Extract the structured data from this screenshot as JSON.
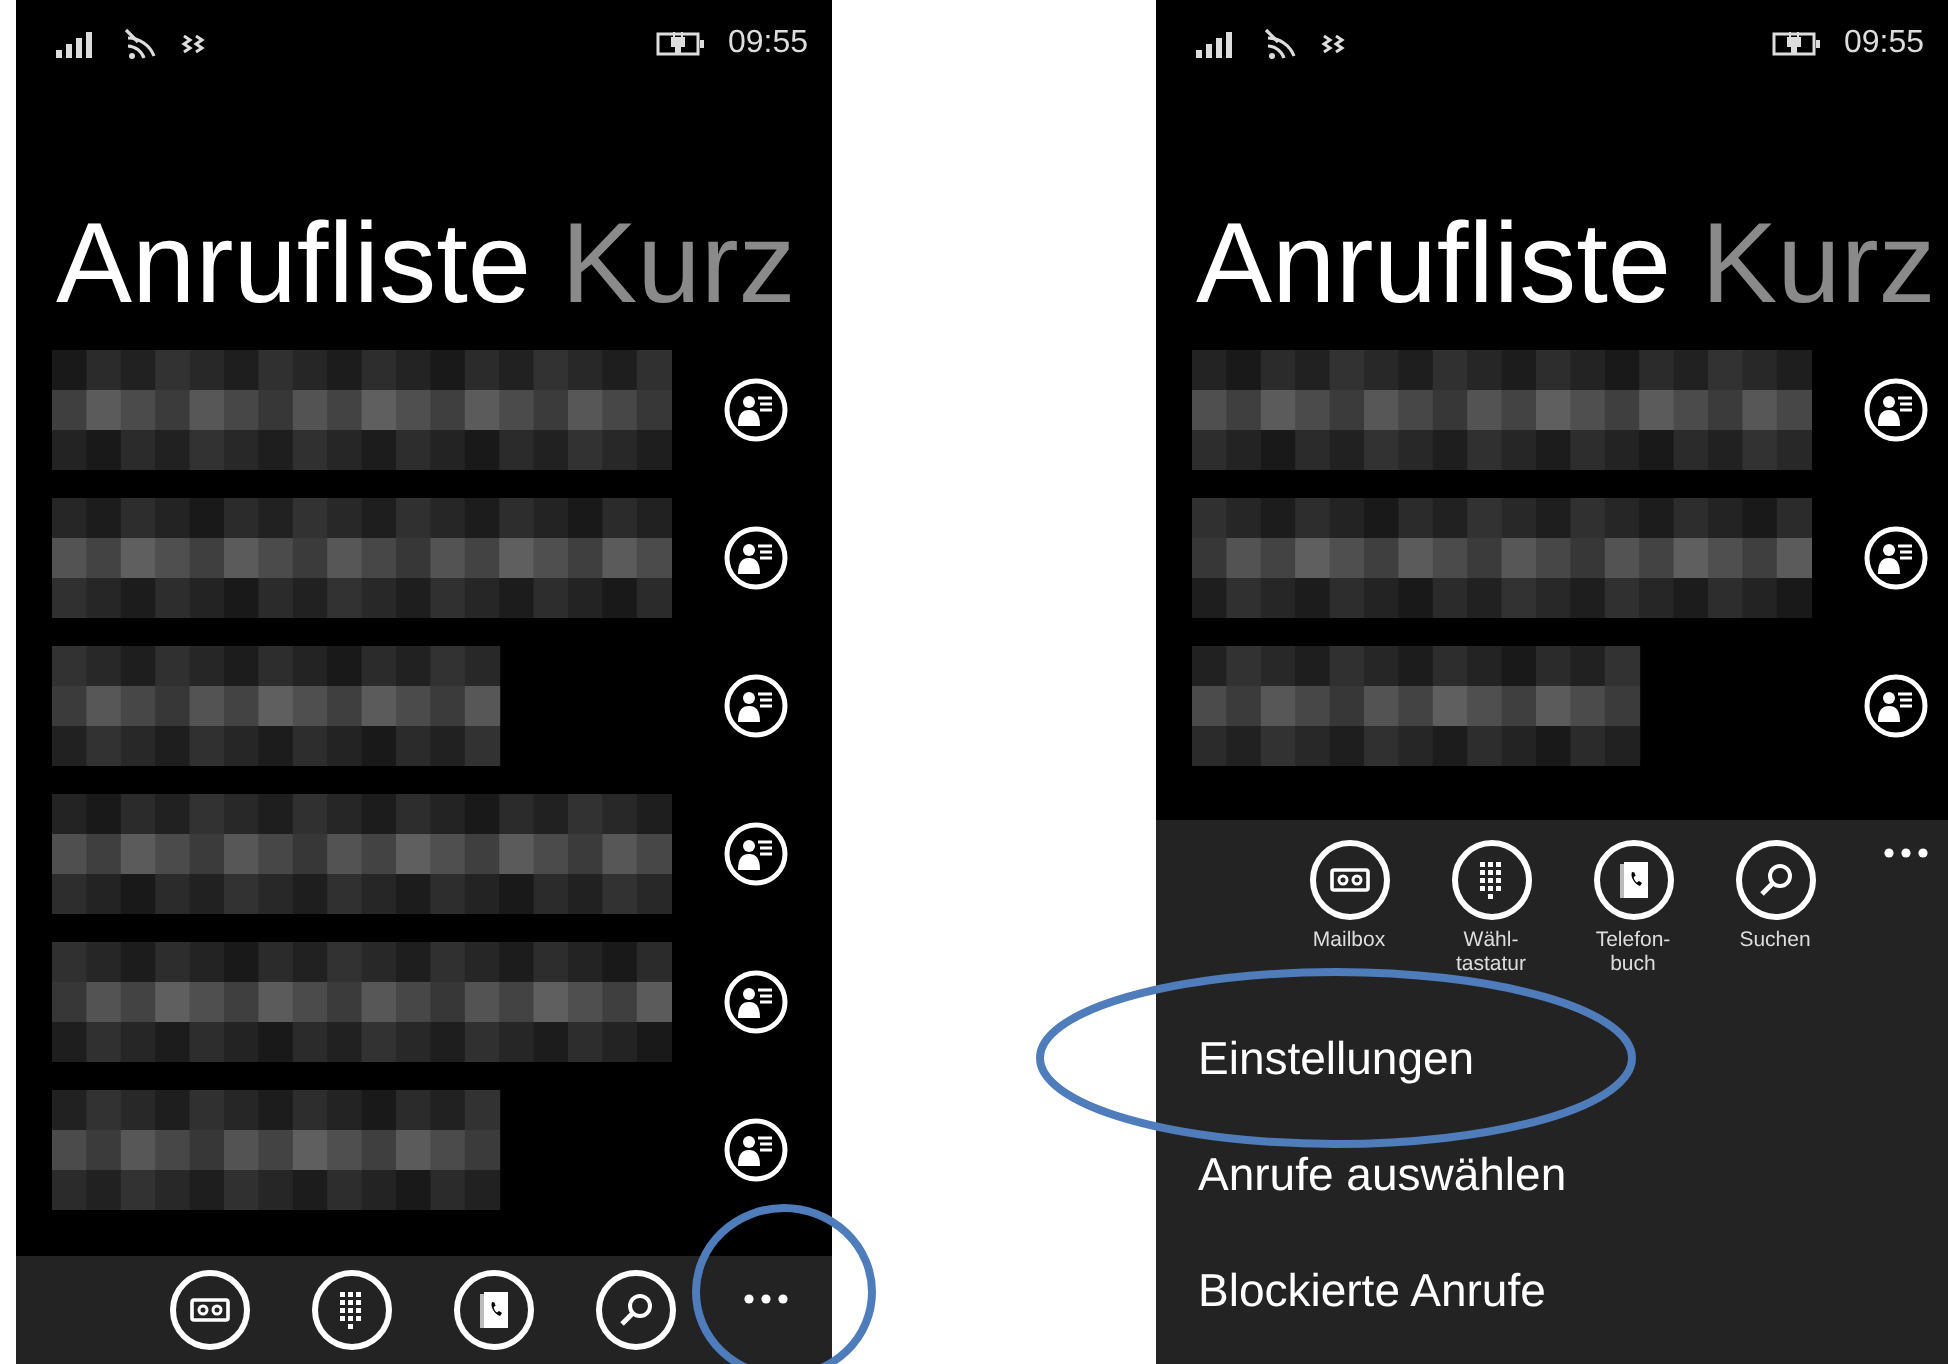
{
  "phones": [
    {
      "status": {
        "time": "09:55"
      },
      "title": "Anrufliste",
      "title_next": "Kurz",
      "rows": [
        {
          "kind": "pixelated"
        },
        {
          "kind": "pixelated"
        },
        {
          "kind": "pixelated"
        },
        {
          "kind": "pixelated"
        },
        {
          "kind": "pixelated"
        },
        {
          "kind": "pixelated"
        }
      ],
      "app_bar": {
        "expanded": false,
        "more_annotated": true,
        "buttons": [
          {
            "kind": "voicemail"
          },
          {
            "kind": "dialpad"
          },
          {
            "kind": "phonebook"
          },
          {
            "kind": "search"
          }
        ]
      }
    },
    {
      "status": {
        "time": "09:55"
      },
      "title": "Anrufliste",
      "title_next": "Kurz",
      "rows": [
        {
          "kind": "pixelated"
        },
        {
          "kind": "pixelated"
        },
        {
          "kind": "pixelated"
        }
      ],
      "app_bar": {
        "expanded": true,
        "buttons": [
          {
            "kind": "voicemail",
            "label": "Mailbox"
          },
          {
            "kind": "dialpad",
            "label": "Wähl-\ntastatur"
          },
          {
            "kind": "phonebook",
            "label": "Telefon-\nbuch"
          },
          {
            "kind": "search",
            "label": "Suchen"
          }
        ],
        "menu": [
          {
            "label": "Einstellungen",
            "annotated": true
          },
          {
            "label": "Anrufe auswählen",
            "annotated": false
          },
          {
            "label": "Blockierte Anrufe",
            "annotated": false
          }
        ]
      }
    }
  ]
}
